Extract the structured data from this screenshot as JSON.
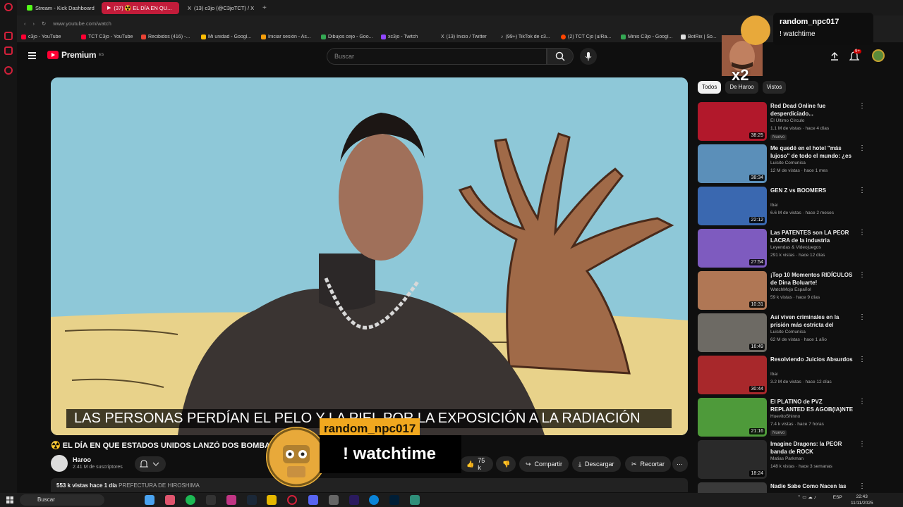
{
  "tabs": [
    {
      "label": "Stream - Kick Dashboard",
      "color": "#53fc18"
    },
    {
      "label": "(37) ☢️ EL DÍA EN QU...",
      "color": "#ff0033",
      "active": true
    },
    {
      "label": "(13) c3jo (@C3joTCT) / X",
      "color": "#000000"
    }
  ],
  "address": {
    "url": "www.youtube.com/watch"
  },
  "bookmarks": [
    {
      "label": "c3jo - YouTube",
      "color": "#ff0033"
    },
    {
      "label": "TCT C3jo - YouTube",
      "color": "#ff0033"
    },
    {
      "label": "Recibidos (416) -...",
      "color": "#ea4335"
    },
    {
      "label": "Mi unidad - Googl...",
      "color": "#fbbc04"
    },
    {
      "label": "Iniciar sesión - As...",
      "color": "#f59e0b"
    },
    {
      "label": "Dibujos cejo - Goo...",
      "color": "#34a853"
    },
    {
      "label": "xc3jo - Twitch",
      "color": "#9146ff"
    },
    {
      "label": "(13) Inicio / Twitter",
      "color": "#ffffff"
    },
    {
      "label": "(99+) TikTok de c3...",
      "color": "#ffffff"
    },
    {
      "label": "(2) TCT Cjo (u/Ra...",
      "color": "#ff4500"
    },
    {
      "label": "Minis C3jo - Googl...",
      "color": "#34a853"
    },
    {
      "label": "BotRix | So...",
      "color": "#dddddd"
    }
  ],
  "header": {
    "brand": "Premium",
    "brand_sup": "ES",
    "search_placeholder": "Buscar",
    "notif_count": "9+"
  },
  "video": {
    "subtitle": "LAS PERSONAS PERDÍAN EL PELO Y LA PIEL POR LA EXPOSICIÓN A LA RADIACIÓN",
    "title": "☢️ EL DÍA EN QUE ESTADOS UNIDOS LANZÓ DOS BOMBAS",
    "channel": "Haroo",
    "subscribers": "2.41 M de suscriptores",
    "likes": "75 k",
    "share": "Compartir",
    "download": "Descargar",
    "clip": "Recortar",
    "views": "553 k vistas",
    "date": "hace 1 día",
    "tag": "PREFECTURA DE HIROSHIMA"
  },
  "chips": [
    "Todos",
    "De Haroo",
    "Vistos"
  ],
  "recommendations": [
    {
      "title": "Red Dead Online fue desperdiciado...",
      "channel": "El Último Círculo",
      "meta": "1.1 M de vistas · hace 4 días",
      "duration": "38:25",
      "badge": "Nuevo",
      "thumb": "#b2182b"
    },
    {
      "title": "Me quedé en el hotel \"más lujoso\" de todo el mundo: ¿es ...",
      "channel": "Luisito Comunica",
      "meta": "12 M de vistas · hace 1 mes",
      "duration": "38:34",
      "badge": "",
      "thumb": "#5b8fb9"
    },
    {
      "title": "GEN Z vs BOOMERS",
      "channel": "Ibai",
      "meta": "6.6 M de vistas · hace 2 meses",
      "duration": "22:12",
      "badge": "",
      "thumb": "#3a68b0"
    },
    {
      "title": "Las PATENTES son LA PEOR LACRA de la industria",
      "channel": "Leyendas & Videojuegos",
      "meta": "291 k vistas · hace 12 días",
      "duration": "27:54",
      "badge": "",
      "thumb": "#7e5bbf"
    },
    {
      "title": "¡Top 10 Momentos RIDÍCULOS de Dina Boluarte!",
      "channel": "WatchMojo Español",
      "meta": "59 k vistas · hace 9 días",
      "duration": "10:31",
      "badge": "",
      "thumb": "#b07755"
    },
    {
      "title": "Así viven criminales en la prisión más estricta del mund...",
      "channel": "Luisito Comunica",
      "meta": "62 M de vistas · hace 1 año",
      "duration": "16:49",
      "badge": "",
      "thumb": "#6d6a64"
    },
    {
      "title": "Resolviendo Juicios Absurdos",
      "channel": "Ibai",
      "meta": "3.2 M de vistas · hace 12 días",
      "duration": "30:44",
      "badge": "",
      "thumb": "#a8282b"
    },
    {
      "title": "El PLATINO de PVZ REPLANTED ES AGOB(IA)NTE",
      "channel": "HuevitoShinno",
      "meta": "7.4 k vistas · hace 7 horas",
      "duration": "21:16",
      "badge": "Nuevo",
      "thumb": "#4e9a3a"
    },
    {
      "title": "Imagine Dragons: la PEOR banda de ROCK",
      "channel": "Matias Parkman",
      "meta": "148 k vistas · hace 3 semanas",
      "duration": "18:24",
      "badge": "",
      "thumb": "#2a2a2a"
    },
    {
      "title": "Nadie Sabe Como Nacen las",
      "channel": "",
      "meta": "",
      "duration": "",
      "badge": "",
      "thumb": "#3a3a3a"
    }
  ],
  "alert": {
    "username": "random_npc017",
    "message": "! watchtime"
  },
  "chat": {
    "username": "random_npc017",
    "message": "! watchtime",
    "multiplier": "x2"
  },
  "taskbar": {
    "search": "Buscar",
    "lang": "ESP",
    "time": "22:43",
    "date": "11/11/2025"
  }
}
